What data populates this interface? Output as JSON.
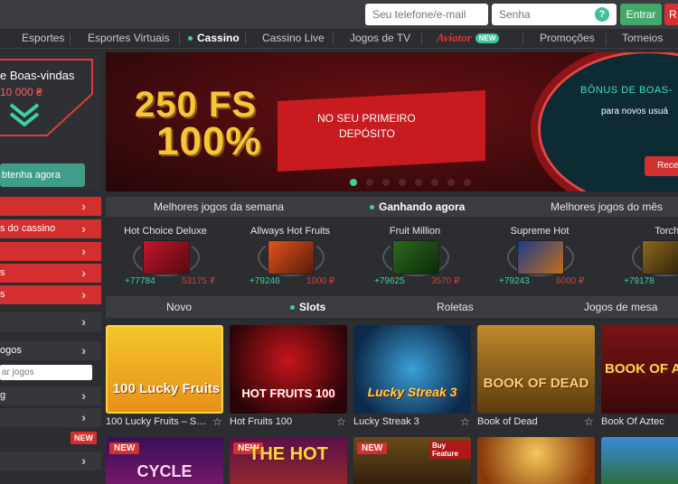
{
  "topbar": {
    "phone_placeholder": "Seu telefone/e-mail",
    "password_placeholder": "Senha",
    "help": "?",
    "login": "Entrar",
    "register": "R"
  },
  "nav": {
    "items": [
      "Esportes",
      "Esportes Virtuais",
      "Cassino",
      "Cassino Live",
      "Jogos de TV",
      "Aviator",
      "Promoções",
      "Torneios"
    ],
    "new_badge": "NEW"
  },
  "sidebar": {
    "promo_title": "e Boas-vindas",
    "promo_amount": "10 000 ₴",
    "promo_button": "btenha agora",
    "rows": [
      "s do cassino",
      "s",
      "s",
      "ogos",
      "ar jogos",
      "g"
    ],
    "search_placeholder": "ar jogos",
    "new_badge": "NEW"
  },
  "banner": {
    "headline_1": "250 FS",
    "headline_2": "100%",
    "sub_1": "NO SEU PRIMEIRO",
    "sub_2": "DEPÓSITO",
    "bonus_title": "BÔNUS DE BOAS-",
    "bonus_sub": "para novos usuá",
    "bonus_button": "Rece"
  },
  "tops": {
    "tabs": [
      "Melhores jogos da semana",
      "Ganhando agora",
      "Melhores jogos do mês"
    ],
    "games": [
      {
        "name": "Hot Choice Deluxe",
        "left": "+77784",
        "right": "53175 ₮"
      },
      {
        "name": "Allways Hot Fruits",
        "left": "+79246",
        "right": "1000 ₽"
      },
      {
        "name": "Fruit Million",
        "left": "+79625",
        "right": "3570 ₽"
      },
      {
        "name": "Supreme Hot",
        "left": "+79243",
        "right": "6000 ₽"
      },
      {
        "name": "Torch Of",
        "left": "+79178",
        "right": ""
      }
    ]
  },
  "categories": [
    "Novo",
    "Slots",
    "Roletas",
    "Jogos de mesa"
  ],
  "games": [
    {
      "title": "100 Lucky Fruits – Spi…",
      "art": "100 Lucky Fruits"
    },
    {
      "title": "Hot Fruits 100",
      "art": "HOT FRUITS 100"
    },
    {
      "title": "Lucky Streak 3",
      "art": "Lucky Streak 3"
    },
    {
      "title": "Book of Dead",
      "art": "BOOK OF DEAD"
    },
    {
      "title": "Book Of Aztec",
      "art": "BOOK OF AZT"
    }
  ],
  "games_row2": [
    {
      "badge": "NEW",
      "art": "CYCLE"
    },
    {
      "badge": "NEW",
      "art": "THE HOT"
    },
    {
      "badge": "NEW",
      "art": "Buy Feature"
    },
    {
      "badge": "",
      "art": ""
    },
    {
      "badge": "",
      "art": ""
    }
  ]
}
